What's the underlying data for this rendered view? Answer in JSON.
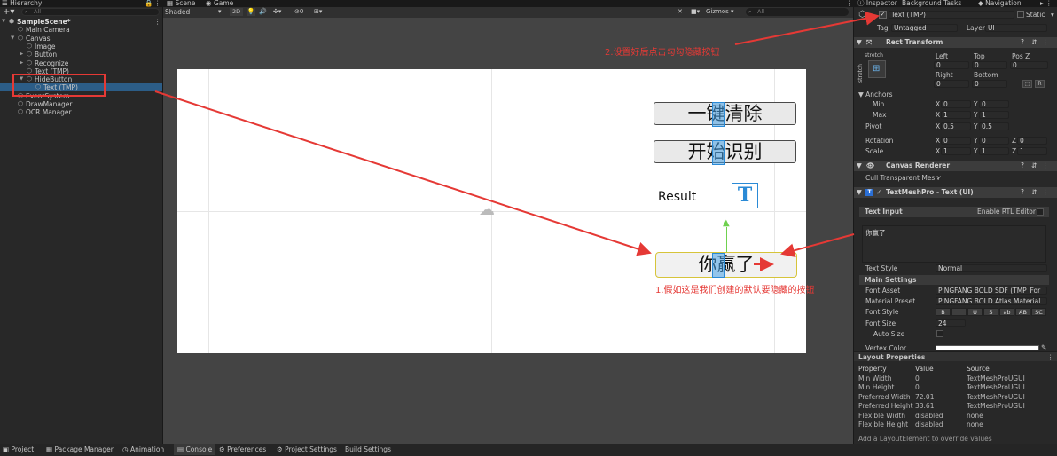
{
  "hierarchy": {
    "tab_label": "Hierarchy",
    "search_placeholder": "All",
    "items": [
      {
        "label": "SampleScene*",
        "depth": 0,
        "toggle": "▼"
      },
      {
        "label": "Main Camera",
        "depth": 1,
        "toggle": ""
      },
      {
        "label": "Canvas",
        "depth": 1,
        "toggle": "▼"
      },
      {
        "label": "Image",
        "depth": 2,
        "toggle": ""
      },
      {
        "label": "Button",
        "depth": 2,
        "toggle": "▶"
      },
      {
        "label": "Recognize",
        "depth": 2,
        "toggle": "▶"
      },
      {
        "label": "Text (TMP)",
        "depth": 2,
        "toggle": ""
      },
      {
        "label": "HideButton",
        "depth": 2,
        "toggle": "▼"
      },
      {
        "label": "Text (TMP)",
        "depth": 3,
        "toggle": ""
      },
      {
        "label": "EventSystem",
        "depth": 1,
        "toggle": ""
      },
      {
        "label": "DrawManager",
        "depth": 1,
        "toggle": ""
      },
      {
        "label": "OCR Manager",
        "depth": 1,
        "toggle": ""
      }
    ]
  },
  "scene": {
    "tabs": [
      "Scene",
      "Game"
    ],
    "shading": "Shaded",
    "mode_2d": "2D",
    "hidden_count": "0",
    "gizmos": "Gizmos",
    "search_placeholder": "All",
    "canvas_buttons": [
      {
        "text": "一键清除"
      },
      {
        "text": "开始识别"
      }
    ],
    "result_label": "Result",
    "t_glyph": "T",
    "hide_button_text": "你赢了",
    "annotation_1": "1.假如这是我们创建的默认要隐藏的按钮",
    "annotation_2": "2.设置好后点击勾勾隐藏按钮",
    "annotation_color": "#e53935"
  },
  "inspector": {
    "tabs": [
      "Inspector",
      "Background Tasks",
      "Navigation"
    ],
    "object_name": "Text (TMP)",
    "static_label": "Static",
    "tag_label": "Tag",
    "tag_value": "Untagged",
    "layer_label": "Layer",
    "layer_value": "UI",
    "rect_transform": {
      "title": "Rect Transform",
      "stretch": "stretch",
      "col_left": "Left",
      "col_top": "Top",
      "col_posz": "Pos Z",
      "left": "0",
      "top": "0",
      "posz": "0",
      "col_right": "Right",
      "col_bottom": "Bottom",
      "right": "0",
      "bottom": "0",
      "anchors_label": "Anchors",
      "min_label": "Min",
      "min_x": "0",
      "min_y": "0",
      "max_label": "Max",
      "max_x": "1",
      "max_y": "1",
      "pivot_label": "Pivot",
      "pivot_x": "0.5",
      "pivot_y": "0.5",
      "rotation_label": "Rotation",
      "rot_x": "0",
      "rot_y": "0",
      "rot_z": "0",
      "scale_label": "Scale",
      "scale_x": "1",
      "scale_y": "1",
      "scale_z": "1",
      "raw_btn": "R"
    },
    "canvas_renderer": {
      "title": "Canvas Renderer",
      "cull_label": "Cull Transparent Mesh",
      "cull_check": "✓"
    },
    "tmp": {
      "title": "TextMeshPro - Text (UI)",
      "text_input_label": "Text Input",
      "rtl_label": "Enable RTL Editor",
      "text_value": "你赢了",
      "text_style_label": "Text Style",
      "text_style_value": "Normal",
      "main_settings": "Main Settings",
      "font_asset_label": "Font Asset",
      "font_asset_value": "PINGFANG BOLD SDF (TMP_For",
      "material_label": "Material Preset",
      "material_value": "PINGFANG BOLD Atlas Material",
      "font_style_label": "Font Style",
      "font_style_buttons": [
        "B",
        "I",
        "U",
        "S",
        "ab",
        "AB",
        "SC"
      ],
      "font_size_label": "Font Size",
      "font_size_value": "24",
      "auto_size_label": "Auto Size",
      "vertex_color_label": "Vertex Color"
    },
    "layout": {
      "title": "Layout Properties",
      "headers": [
        "Property",
        "Value",
        "Source"
      ],
      "rows": [
        [
          "Min Width",
          "0",
          "TextMeshProUGUI"
        ],
        [
          "Min Height",
          "0",
          "TextMeshProUGUI"
        ],
        [
          "Preferred Width",
          "72.01",
          "TextMeshProUGUI"
        ],
        [
          "Preferred Height",
          "33.61",
          "TextMeshProUGUI"
        ],
        [
          "Flexible Width",
          "disabled",
          "none"
        ],
        [
          "Flexible Height",
          "disabled",
          "none"
        ]
      ],
      "footer": "Add a LayoutElement to override values"
    }
  },
  "bottom_tabs": [
    "Project",
    "Package Manager",
    "Animation",
    "Console",
    "Preferences",
    "Project Settings",
    "Build Settings"
  ]
}
